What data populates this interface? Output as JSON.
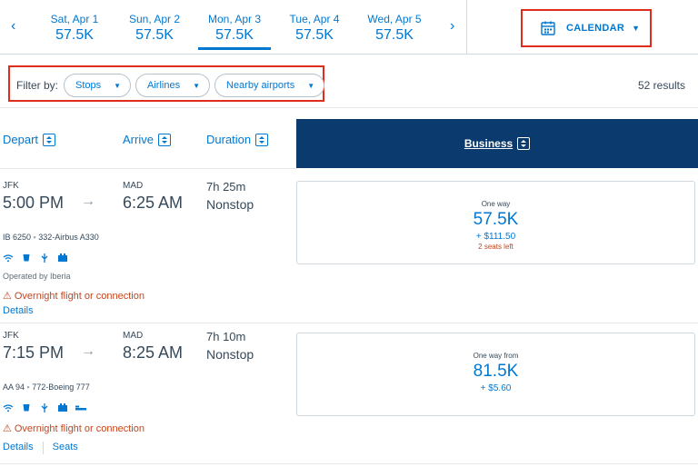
{
  "date_nav": {
    "prev_arrow": "‹",
    "next_arrow": "›",
    "dates": [
      {
        "label": "Sat, Apr 1",
        "price": "57.5K"
      },
      {
        "label": "Sun, Apr 2",
        "price": "57.5K"
      },
      {
        "label": "Mon, Apr 3",
        "price": "57.5K"
      },
      {
        "label": "Tue, Apr 4",
        "price": "57.5K"
      },
      {
        "label": "Wed, Apr 5",
        "price": "57.5K"
      }
    ],
    "active_index": 2
  },
  "calendar": {
    "label": "CALENDAR",
    "icon": "calendar-icon"
  },
  "filters": {
    "label": "Filter by:",
    "chips": [
      {
        "label": "Stops"
      },
      {
        "label": "Airlines"
      },
      {
        "label": "Nearby airports"
      }
    ]
  },
  "results_count": "52 results",
  "columns": {
    "depart": "Depart",
    "arrive": "Arrive",
    "duration": "Duration",
    "business": "Business"
  },
  "flights": [
    {
      "depart_airport": "JFK",
      "depart_time": "5:00 PM",
      "arrive_airport": "MAD",
      "arrive_time": "6:25 AM",
      "duration": "7h 25m",
      "stops": "Nonstop",
      "flight_number": "IB 6250",
      "aircraft": "332-Airbus A330",
      "operated_by": "Operated by Iberia",
      "warning": "Overnight flight or connection",
      "links": [
        "Details"
      ],
      "fare": {
        "label": "One way",
        "price": "57.5K",
        "tax": "+ $111.50",
        "seats": "2 seats left"
      }
    },
    {
      "depart_airport": "JFK",
      "depart_time": "7:15 PM",
      "arrive_airport": "MAD",
      "arrive_time": "8:25 AM",
      "duration": "7h 10m",
      "stops": "Nonstop",
      "flight_number": "AA 94",
      "aircraft": "772-Boeing 777",
      "warning": "Overnight flight or connection",
      "links": [
        "Details",
        "Seats"
      ],
      "fare": {
        "label": "One way from",
        "price": "81.5K",
        "tax": "+ $5.60"
      }
    }
  ],
  "colors": {
    "accent": "#0078d2",
    "header_navy": "#0b3a6e",
    "warning": "#c3461d",
    "highlight_box": "#e02c1c"
  }
}
